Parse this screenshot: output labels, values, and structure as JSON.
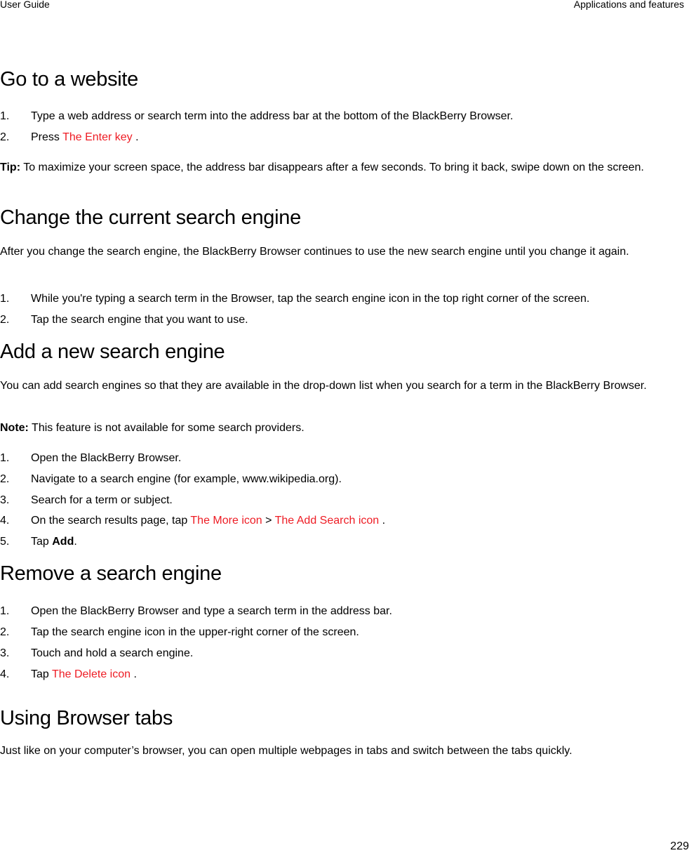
{
  "header": {
    "left": "User Guide",
    "right": "Applications and features"
  },
  "sections": {
    "go_to_website": {
      "title": "Go to a website",
      "steps": [
        "Type a web address or search term into the address bar at the bottom of the BlackBerry Browser.",
        {
          "pre": "Press ",
          "icon": "The Enter key",
          "post": " ."
        }
      ],
      "tip_label": "Tip:",
      "tip_text": " To maximize your screen space, the address bar disappears after a few seconds. To bring it back, swipe down on the screen."
    },
    "change_search_engine": {
      "title": "Change the current search engine",
      "intro": "After you change the search engine, the BlackBerry Browser continues to use the new search engine until you change it again.",
      "steps": [
        "While you're typing a search term in the Browser, tap the search engine icon in the top right corner of the screen.",
        "Tap the search engine that you want to use."
      ]
    },
    "add_search_engine": {
      "title": "Add a new search engine",
      "intro": "You can add search engines so that they are available in the drop-down list when you search for a term in the BlackBerry Browser.",
      "note_label": "Note:",
      "note_text": " This feature is not available for some search providers.",
      "steps": [
        "Open the BlackBerry Browser.",
        "Navigate to a search engine (for example, www.wikipedia.org).",
        "Search for a term or subject.",
        {
          "pre": "On the search results page, tap ",
          "icon1": "The More icon",
          "sep": " > ",
          "icon2": "The Add Search icon",
          "post": " ."
        },
        {
          "pre": "Tap ",
          "bold": "Add",
          "post": "."
        }
      ]
    },
    "remove_search_engine": {
      "title": "Remove a search engine",
      "steps": [
        "Open the BlackBerry Browser and type a search term in the address bar.",
        "Tap the search engine icon in the upper-right corner of the screen.",
        "Touch and hold a search engine.",
        {
          "pre": "Tap ",
          "icon": "The Delete icon",
          "post": " ."
        }
      ]
    },
    "browser_tabs": {
      "title": "Using Browser tabs",
      "intro": "Just like on your computer’s browser, you can open multiple webpages in tabs and switch between the tabs quickly."
    }
  },
  "numbers": [
    "1.",
    "2.",
    "3.",
    "4.",
    "5."
  ],
  "page_number": "229",
  "colors": {
    "link_red": "#ee1c24",
    "text": "#000000"
  }
}
